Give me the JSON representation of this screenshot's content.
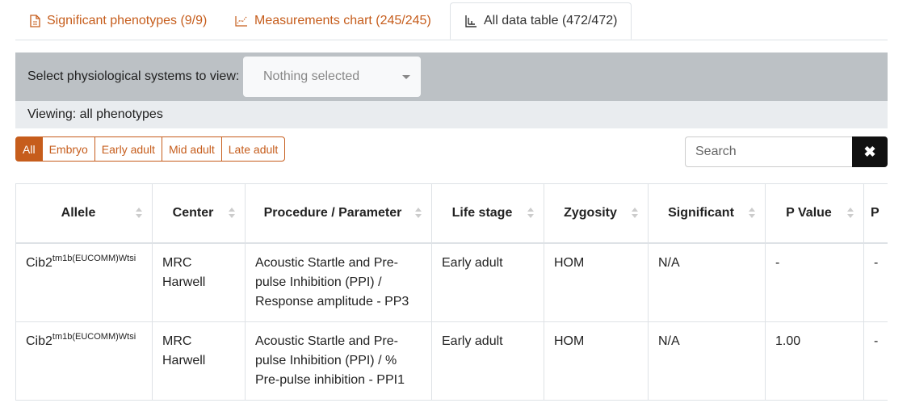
{
  "tabs": [
    {
      "label": "Significant phenotypes (9/9)",
      "icon": "file-icon",
      "active": false
    },
    {
      "label": "Measurements chart (245/245)",
      "icon": "chart-icon",
      "active": false
    },
    {
      "label": "All data table (472/472)",
      "icon": "table-icon",
      "active": true
    }
  ],
  "filter": {
    "label": "Select physiological systems to view:",
    "select_value": "Nothing selected",
    "viewing": "Viewing: all phenotypes"
  },
  "life_stages": [
    "All",
    "Embryo",
    "Early adult",
    "Mid adult",
    "Late adult"
  ],
  "active_stage": "All",
  "search": {
    "placeholder": "Search",
    "clear_icon": "close-icon"
  },
  "table": {
    "columns": [
      "Allele",
      "Center",
      "Procedure / Parameter",
      "Life stage",
      "Zygosity",
      "Significant",
      "P Value",
      "P"
    ],
    "rows": [
      {
        "allele_base": "Cib2",
        "allele_sup": "tm1b(EUCOMM)Wtsi",
        "center": "MRC Harwell",
        "procedure": "Acoustic Startle and Pre-pulse Inhibition (PPI) / Response amplitude - PP3",
        "life_stage": "Early adult",
        "zygosity": "HOM",
        "significant": "N/A",
        "p_value": "-",
        "extra": "-"
      },
      {
        "allele_base": "Cib2",
        "allele_sup": "tm1b(EUCOMM)Wtsi",
        "center": "MRC Harwell",
        "procedure": "Acoustic Startle and Pre-pulse Inhibition (PPI) / % Pre-pulse inhibition - PPI1",
        "life_stage": "Early adult",
        "zygosity": "HOM",
        "significant": "N/A",
        "p_value": "1.00",
        "extra": "-"
      }
    ]
  },
  "colors": {
    "accent": "#c65d1c",
    "filter_bg": "#bcc1c5",
    "viewing_bg": "#e9ecef"
  }
}
